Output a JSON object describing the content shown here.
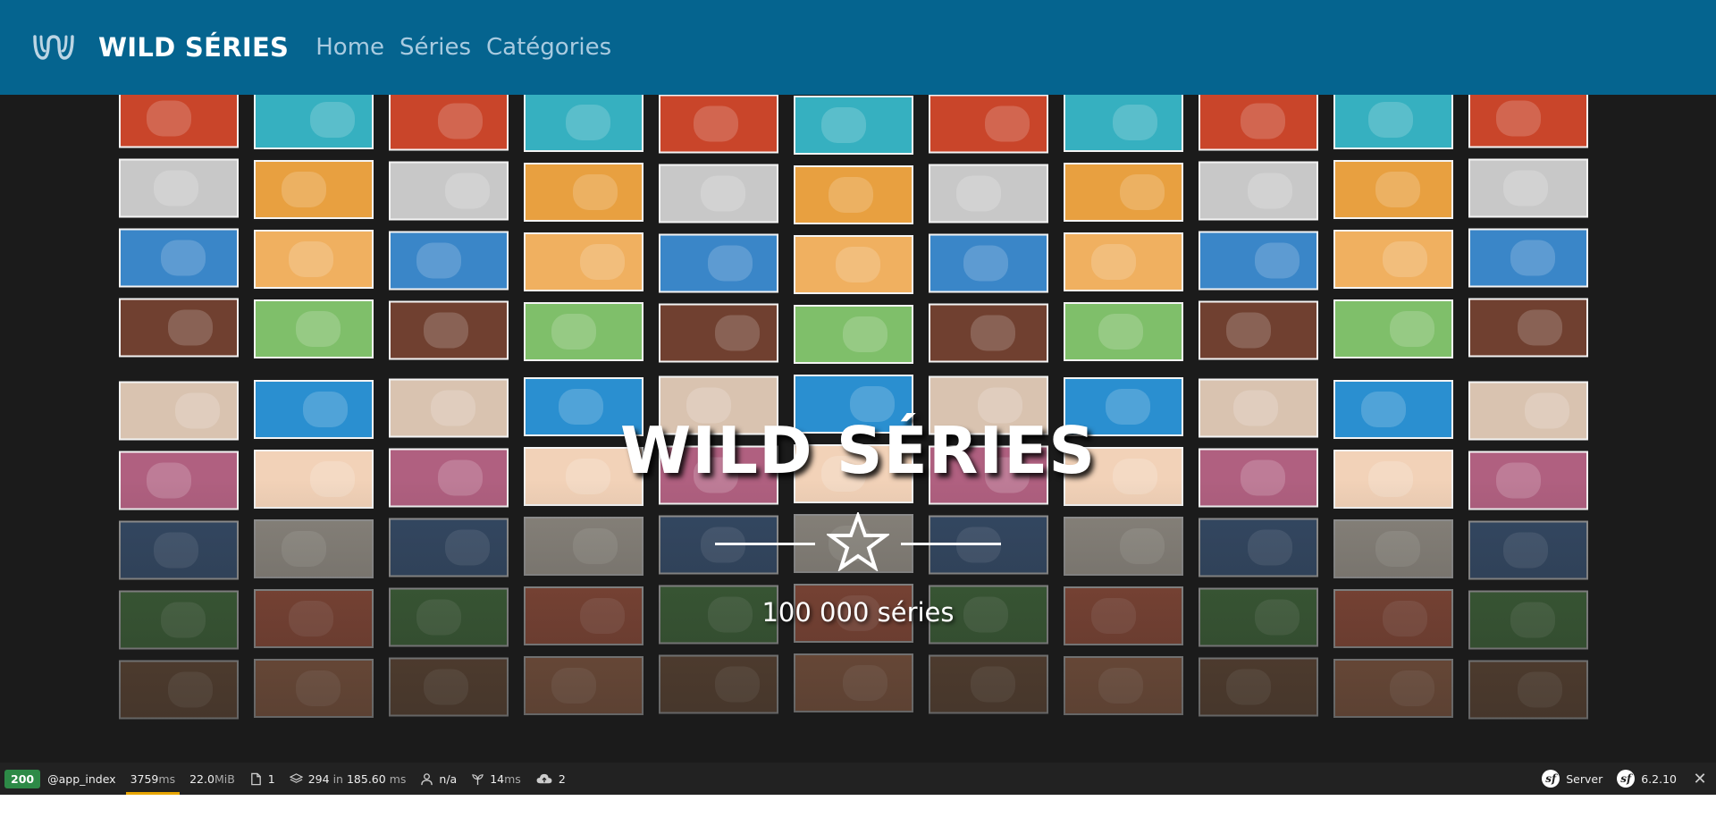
{
  "navbar": {
    "logo_icon": "wild-logo-icon",
    "brand": "WILD SÉRIES",
    "links": [
      {
        "label": "Home"
      },
      {
        "label": "Séries"
      },
      {
        "label": "Catégories"
      }
    ],
    "colors": {
      "background": "#05648f",
      "link": "#a9cbe0",
      "brand": "#ffffff"
    }
  },
  "hero": {
    "background_image": "video-wall-of-screens",
    "title": "WILD SÉRIES",
    "divider_icon": "star-icon",
    "subtitle": "100 000 séries"
  },
  "debug_toolbar": {
    "status_code": "200",
    "route": "@app_index",
    "time": {
      "value": "3759",
      "unit": "ms"
    },
    "memory": {
      "value": "22.0",
      "unit": "MiB"
    },
    "logs": {
      "icon": "file-icon",
      "count": "1"
    },
    "cache": {
      "icon": "layers-icon",
      "calls": "294",
      "in_label": "in",
      "time": "185.60",
      "unit": "ms"
    },
    "user": {
      "icon": "user-icon",
      "value": "n/a"
    },
    "twig": {
      "icon": "leaf-icon",
      "value": "14",
      "unit": "ms"
    },
    "ajax": {
      "icon": "cloud-icon",
      "count": "2"
    },
    "server": {
      "icon": "symfony-icon",
      "label": "Server"
    },
    "version": {
      "icon": "symfony-icon",
      "value": "6.2.10"
    },
    "close_icon": "close-icon",
    "colors": {
      "status_ok": "#2d8a47",
      "time_underline": "#e8a600"
    }
  }
}
